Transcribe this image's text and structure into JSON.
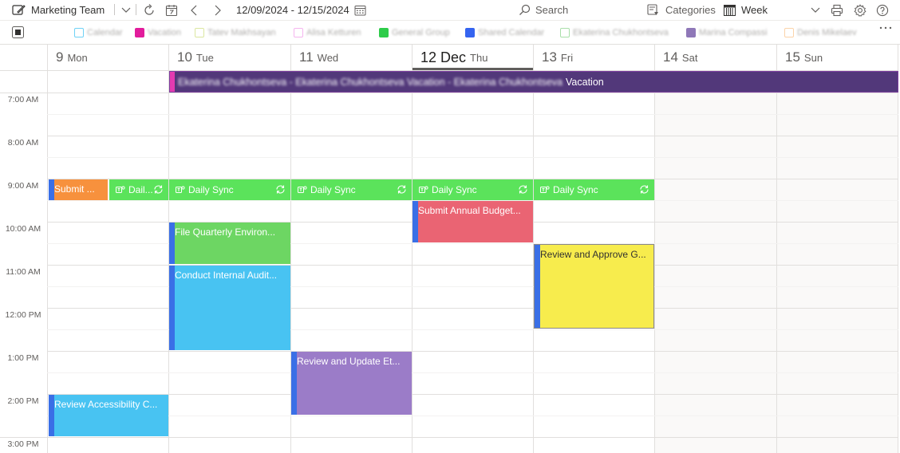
{
  "toolbar": {
    "calendar_name": "Marketing Team",
    "date_range": "12/09/2024 - 12/15/2024",
    "search_placeholder": "Search",
    "categories_label": "Categories",
    "view_label": "Week"
  },
  "categories": [
    {
      "label": "Calendar",
      "color": "#6fd2f6",
      "outline": true
    },
    {
      "label": "Vacation",
      "color": "#e21c9c",
      "outline": false
    },
    {
      "label": "Tatev Makhsayan",
      "color": "#dbe7a0",
      "outline": true
    },
    {
      "label": "Alisa Ketturen",
      "color": "#f5b5ef",
      "outline": true
    },
    {
      "label": "General Group",
      "color": "#2ecc4a",
      "outline": false
    },
    {
      "label": "Shared Calendar",
      "color": "#3564f0",
      "outline": false
    },
    {
      "label": "Ekaterina Chukhontseva",
      "color": "#a9dfa9",
      "outline": true
    },
    {
      "label": "Marina Compassi",
      "color": "#8f78b8",
      "outline": false
    },
    {
      "label": "Denis Mikelaev",
      "color": "#fbd3a9",
      "outline": true
    }
  ],
  "days": [
    {
      "num": "9",
      "name": "Mon"
    },
    {
      "num": "10",
      "name": "Tue"
    },
    {
      "num": "11",
      "name": "Wed"
    },
    {
      "num": "12 Dec",
      "name": "Thu",
      "today": true
    },
    {
      "num": "13",
      "name": "Fri"
    },
    {
      "num": "14",
      "name": "Sat"
    },
    {
      "num": "15",
      "name": "Sun"
    }
  ],
  "times": [
    "7:00 AM",
    "8:00 AM",
    "9:00 AM",
    "10:00 AM",
    "11:00 AM",
    "12:00 PM",
    "1:00 PM",
    "2:00 PM",
    "3:00 PM"
  ],
  "allday_event": {
    "blurred_text": "Ekaterina Chukhontseva - Ekaterina Chukhontseva Vacation - Ekaterina Chukhontseva",
    "suffix": "Vacation"
  },
  "events": {
    "mon_submit": "Submit ...",
    "mon_sync": "Dail...",
    "tue_sync": "Daily Sync",
    "wed_sync": "Daily Sync",
    "thu_sync": "Daily Sync",
    "fri_sync": "Daily Sync",
    "thu_budget": "Submit Annual Budget...",
    "tue_file": "File Quarterly Environ...",
    "fri_review": "Review and Approve G...",
    "tue_audit": "Conduct Internal Audit...",
    "wed_review": "Review and Update Et...",
    "mon_access": "Review Accessibility C..."
  },
  "colors": {
    "sync": "#5be35b",
    "submit_orange": "#f7913d",
    "budget_red": "#ea6473",
    "file_green": "#6dd663",
    "review_yellow": "#f7ec4d",
    "audit_blue": "#48c3f2",
    "update_purple": "#9b7cc8",
    "accent": "#3a6fe6",
    "allday_purple": "#52387a"
  }
}
